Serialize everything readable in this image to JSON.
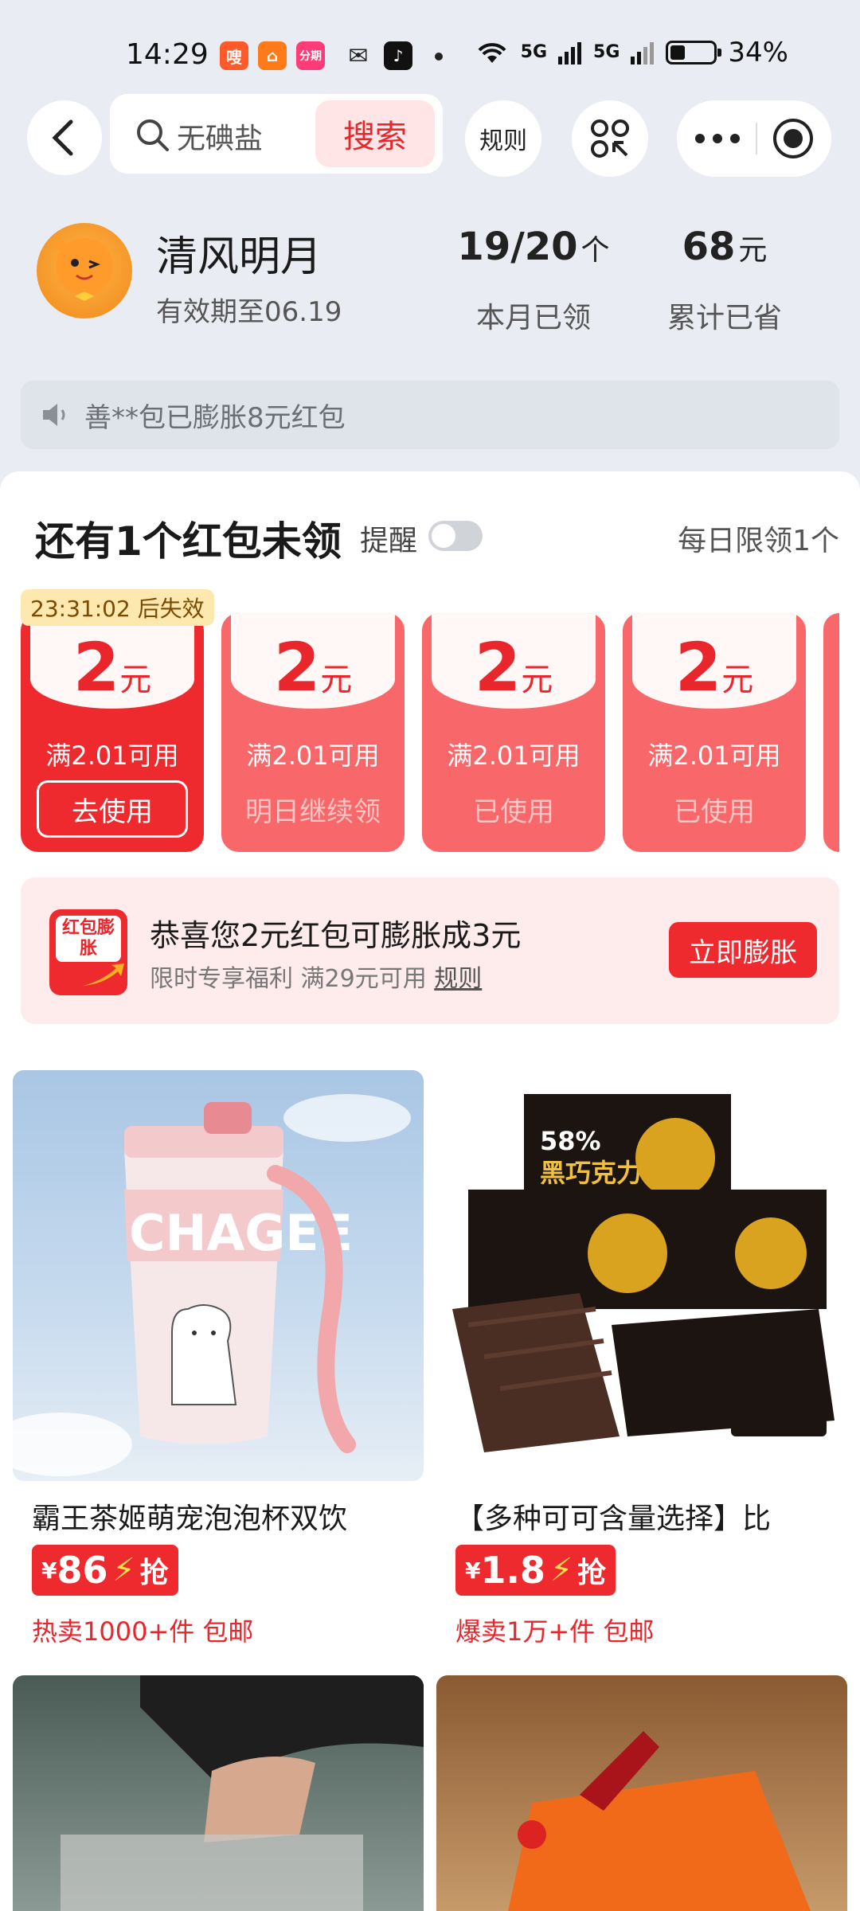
{
  "status_bar": {
    "time": "14:29",
    "apps": [
      {
        "label": "嗖",
        "color": "#ff5a2a"
      },
      {
        "label": "⌂",
        "color": "#ff7b1a"
      },
      {
        "label": "分期",
        "color": "#ff3c78"
      },
      {
        "label": "✉",
        "color": "#222222"
      },
      {
        "label": "♪",
        "color": "#111111"
      }
    ],
    "network1": "5G",
    "network2": "5G",
    "battery": "34%",
    "battery_level": 0.34
  },
  "nav": {
    "search_placeholder": "无碘盐",
    "search_button": "搜索",
    "rules": "规则"
  },
  "profile": {
    "name": "清风明月",
    "valid_until": "有效期至06.19",
    "claimed_value": "19/20",
    "claimed_unit": "个",
    "claimed_label": "本月已领",
    "saved_value": "68",
    "saved_unit": "元",
    "saved_label": "累计已省"
  },
  "notice": {
    "text": "善**包已膨胀8元红包"
  },
  "coupons_section": {
    "title": "还有1个红包未领",
    "remind_label": "提醒",
    "daily_limit": "每日限领1个",
    "timer": "23:31:02 后失效",
    "coupons": [
      {
        "amount": "2",
        "unit": "元",
        "condition": "满2.01可用",
        "action": "去使用"
      },
      {
        "amount": "2",
        "unit": "元",
        "condition": "满2.01可用",
        "action": "明日继续领"
      },
      {
        "amount": "2",
        "unit": "元",
        "condition": "满2.01可用",
        "action": "已使用"
      },
      {
        "amount": "2",
        "unit": "元",
        "condition": "满2.01可用",
        "action": "已使用"
      }
    ]
  },
  "expand_banner": {
    "icon_text": "红包膨胀",
    "title": "恭喜您2元红包可膨胀成3元",
    "subtitle": "限时专享福利 满29元可用",
    "rule_link": "规则",
    "button": "立即膨胀"
  },
  "products": [
    {
      "title": "霸王茶姬萌宠泡泡杯双饮",
      "currency": "¥",
      "price": "86",
      "grab": "抢",
      "sold": "热卖1000+件 包邮"
    },
    {
      "title": "【多种可可含量选择】比",
      "currency": "¥",
      "price": "1.8",
      "grab": "抢",
      "sold": "爆卖1万+件 包邮"
    }
  ],
  "product_images": {
    "cup_text": "CHAGEE",
    "choco_badge": "58%",
    "choco_label": "黑巧克力"
  }
}
